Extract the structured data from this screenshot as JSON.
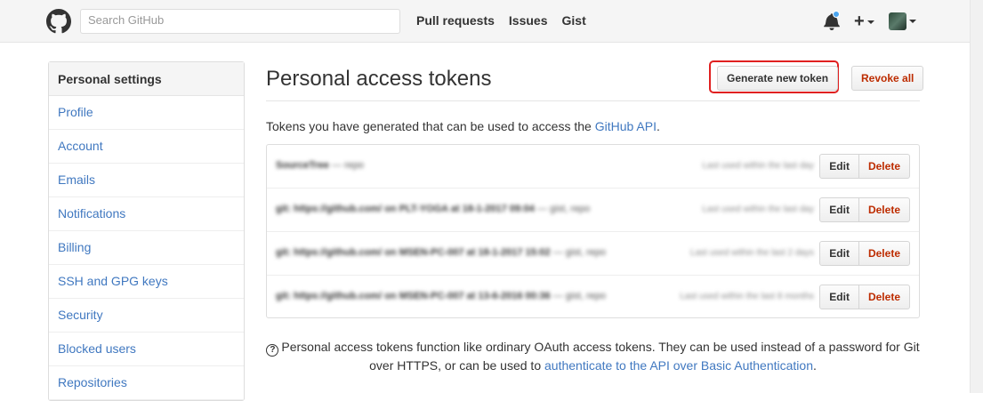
{
  "header": {
    "search_placeholder": "Search GitHub",
    "nav": [
      "Pull requests",
      "Issues",
      "Gist"
    ],
    "plus": "+"
  },
  "sidebar": {
    "title": "Personal settings",
    "items": [
      "Profile",
      "Account",
      "Emails",
      "Notifications",
      "Billing",
      "SSH and GPG keys",
      "Security",
      "Blocked users",
      "Repositories"
    ]
  },
  "main": {
    "title": "Personal access tokens",
    "generate_label": "Generate new token",
    "revoke_label": "Revoke all",
    "intro_text": "Tokens you have generated that can be used to access the ",
    "intro_link": "GitHub API",
    "intro_end": ".",
    "tokens": [
      {
        "name": "SourceTree",
        "scopes": " — repo",
        "meta": "Last used within the last day",
        "edit": "Edit",
        "delete": "Delete"
      },
      {
        "name": "git: https://github.com/ on PLT-YOGA at 18-1-2017 09:04",
        "scopes": " — gist, repo",
        "meta": "Last used within the last day",
        "edit": "Edit",
        "delete": "Delete"
      },
      {
        "name": "git: https://github.com/ on MSEN-PC-007 at 18-1-2017 15:02",
        "scopes": " — gist, repo",
        "meta": "Last used within the last 2 days",
        "edit": "Edit",
        "delete": "Delete"
      },
      {
        "name": "git: https://github.com/ on MSEN-PC-007 at 13-6-2016 00:36",
        "scopes": " — gist, repo",
        "meta": "Last used within the last 8 months",
        "edit": "Edit",
        "delete": "Delete"
      }
    ],
    "note_text": "Personal access tokens function like ordinary OAuth access tokens. They can be used instead of a password for Git over HTTPS, or can be used to ",
    "note_link": "authenticate to the API over Basic Authentication",
    "note_end": ".",
    "note_icon": "?"
  },
  "colors": {
    "link": "#4078c0",
    "danger": "#bd2c00",
    "highlight": "#e02020",
    "notification": "#4aa5f0"
  }
}
